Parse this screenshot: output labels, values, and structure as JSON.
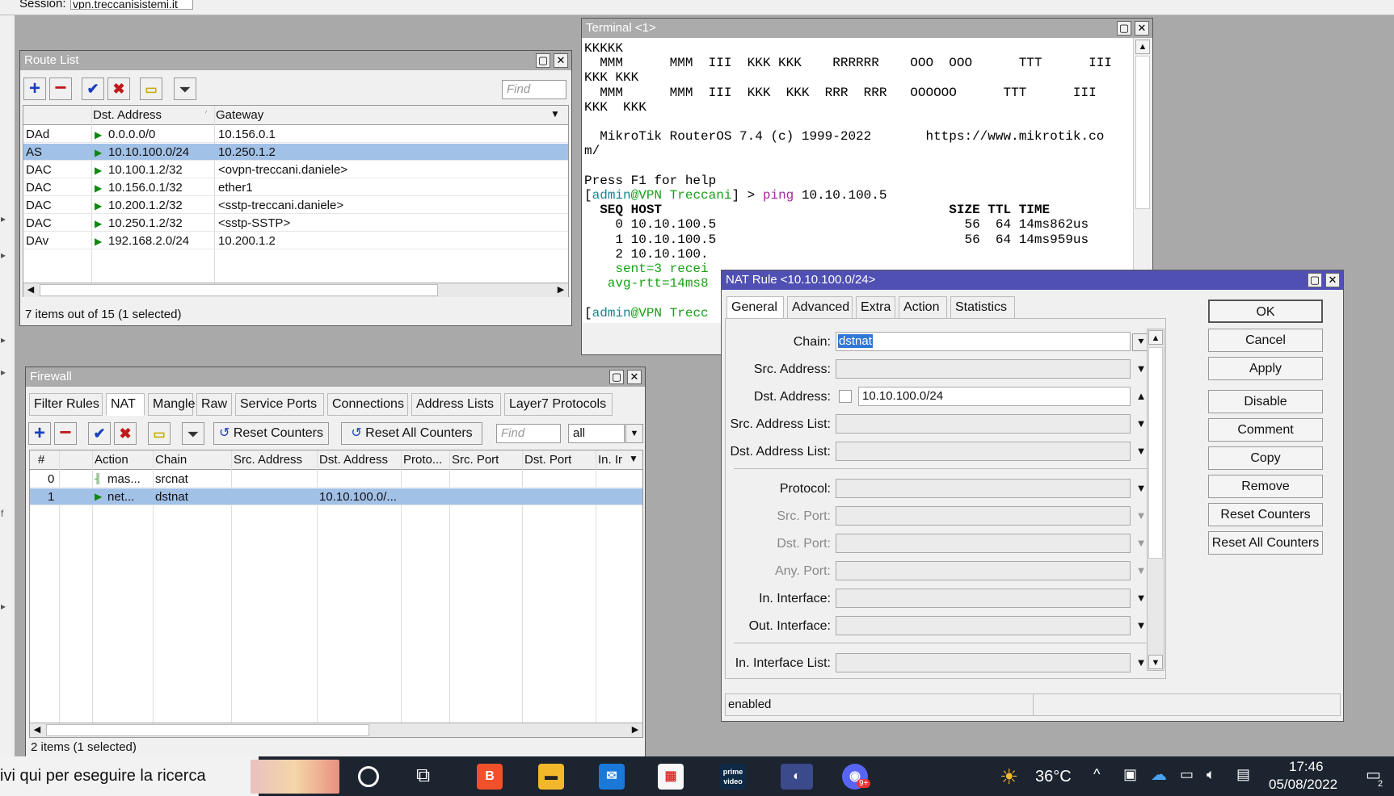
{
  "session": {
    "label": "Session:",
    "value": "vpn.treccanisistemi.it"
  },
  "route_list": {
    "title": "Route List",
    "find_placeholder": "Find",
    "columns": [
      "Dst. Address",
      "Gateway"
    ],
    "rows": [
      {
        "flags": "DAd",
        "dst": "0.0.0.0/0",
        "gw": "10.156.0.1"
      },
      {
        "flags": "AS",
        "dst": "10.10.100.0/24",
        "gw": "10.250.1.2"
      },
      {
        "flags": "DAC",
        "dst": "10.100.1.2/32",
        "gw": "<ovpn-treccani.daniele>"
      },
      {
        "flags": "DAC",
        "dst": "10.156.0.1/32",
        "gw": "ether1"
      },
      {
        "flags": "DAC",
        "dst": "10.200.1.2/32",
        "gw": "<sstp-treccani.daniele>"
      },
      {
        "flags": "DAC",
        "dst": "10.250.1.2/32",
        "gw": "<sstp-SSTP>"
      },
      {
        "flags": "DAv",
        "dst": "192.168.2.0/24",
        "gw": "10.200.1.2"
      }
    ],
    "selected_index": 1,
    "status": "7 items out of 15 (1 selected)"
  },
  "firewall": {
    "title": "Firewall",
    "tabs": [
      "Filter Rules",
      "NAT",
      "Mangle",
      "Raw",
      "Service Ports",
      "Connections",
      "Address Lists",
      "Layer7 Protocols"
    ],
    "active_tab": "NAT",
    "reset_counters": "Reset Counters",
    "reset_all_counters": "Reset All Counters",
    "find_placeholder": "Find",
    "filter_value": "all",
    "columns": [
      "#",
      "Action",
      "Chain",
      "Src. Address",
      "Dst. Address",
      "Proto...",
      "Src. Port",
      "Dst. Port",
      "In. Ir"
    ],
    "rows": [
      {
        "num": "0",
        "action": "mas...",
        "chain": "srcnat",
        "dst": ""
      },
      {
        "num": "1",
        "action": "net...",
        "chain": "dstnat",
        "dst": "10.10.100.0/..."
      }
    ],
    "selected_index": 1,
    "status": "2 items (1 selected)"
  },
  "terminal": {
    "title": "Terminal <1>",
    "logo_lines": [
      "KKKKK",
      "  MMM      MMM  III  KKK KKK    RRRRRR    OOO  OOO      TTT      III",
      "KKK KKK",
      "  MMM      MMM  III  KKK  KKK  RRR  RRR   OOOOOO      TTT      III",
      "KKK  KKK",
      "",
      "  MikroTik RouterOS 7.4 (c) 1999-2022       https://www.mikrotik.co",
      "m/",
      "",
      "Press F1 for help"
    ],
    "prompt_user": "admin",
    "prompt_host": "@VPN Treccani",
    "prompt_open": "[",
    "prompt_close": "] > ",
    "command": "ping",
    "command_arg": " 10.10.100.5",
    "ping_header": "  SEQ HOST                                     SIZE TTL TIME",
    "ping_rows": [
      "    0 10.10.100.5                                56  64 14ms862us",
      "    1 10.10.100.5                                56  64 14ms959us",
      "    2 10.10.100."
    ],
    "summary1": "    sent=3 recei",
    "summary2": "   avg-rtt=14ms8",
    "last_prompt_host": "@VPN Trecc"
  },
  "nat_rule": {
    "title": "NAT Rule <10.10.100.0/24>",
    "tabs": [
      "General",
      "Advanced",
      "Extra",
      "Action",
      "Statistics"
    ],
    "active_tab": "General",
    "fields": {
      "chain": {
        "label": "Chain:",
        "value": "dstnat"
      },
      "src_address": {
        "label": "Src. Address:",
        "value": ""
      },
      "dst_address": {
        "label": "Dst. Address:",
        "value": "10.10.100.0/24"
      },
      "src_address_list": {
        "label": "Src. Address List:",
        "value": ""
      },
      "dst_address_list": {
        "label": "Dst. Address List:",
        "value": ""
      },
      "protocol": {
        "label": "Protocol:",
        "value": ""
      },
      "src_port": {
        "label": "Src. Port:",
        "value": ""
      },
      "dst_port": {
        "label": "Dst. Port:",
        "value": ""
      },
      "any_port": {
        "label": "Any. Port:",
        "value": ""
      },
      "in_interface": {
        "label": "In. Interface:",
        "value": ""
      },
      "out_interface": {
        "label": "Out. Interface:",
        "value": ""
      },
      "in_interface_list": {
        "label": "In. Interface List:",
        "value": ""
      }
    },
    "buttons": {
      "ok": "OK",
      "cancel": "Cancel",
      "apply": "Apply",
      "disable": "Disable",
      "comment": "Comment",
      "copy": "Copy",
      "remove": "Remove",
      "reset_counters": "Reset Counters",
      "reset_all_counters": "Reset All Counters"
    },
    "status": "enabled"
  },
  "taskbar": {
    "search_text": "ivi qui per eseguire la ricerca",
    "weather": "36°C",
    "time": "17:46",
    "date": "05/08/2022",
    "notif_count": "2",
    "discord_badge": "9+",
    "prime_label": "prime video"
  },
  "colors": {
    "title_active": "#5050b4",
    "title_inactive": "#ababab",
    "selected_row": "#a2c1e7",
    "prompt_cyan": "#18868a",
    "command_magenta": "#a02aa0"
  }
}
